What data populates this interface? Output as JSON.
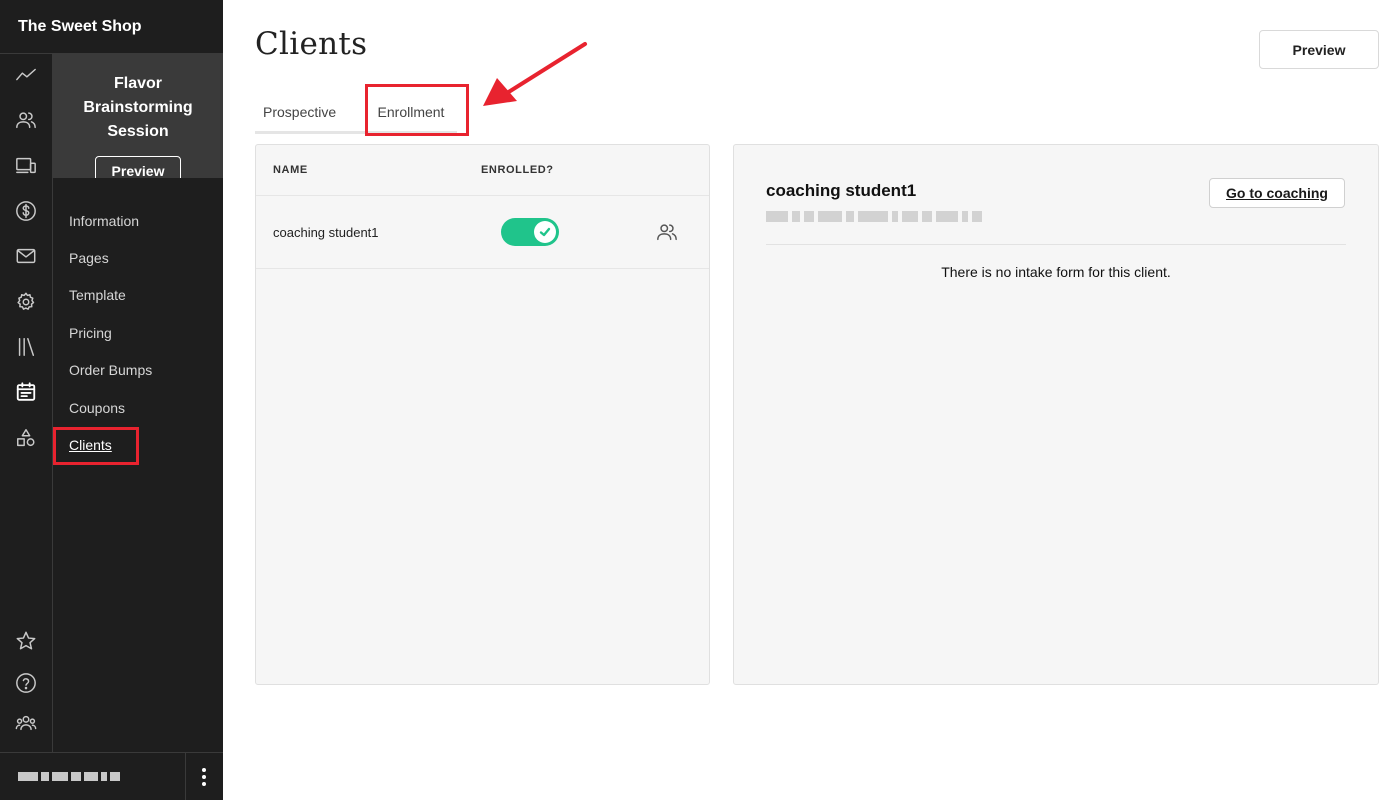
{
  "brand": {
    "name": "The Sweet Shop"
  },
  "rail": {
    "icons": [
      "analytics-icon",
      "people-icon",
      "devices-icon",
      "dollar-icon",
      "mail-icon",
      "settings-icon",
      "library-icon",
      "calendar-icon",
      "shapes-icon",
      "star-icon",
      "help-icon",
      "community-icon"
    ],
    "active": "calendar-icon"
  },
  "product": {
    "title": "Flavor Brainstorming Session",
    "preview_label": "Preview"
  },
  "menu": {
    "items": [
      "Information",
      "Pages",
      "Template",
      "Pricing",
      "Order Bumps",
      "Coupons",
      "Clients"
    ],
    "selected": "Clients"
  },
  "main": {
    "title": "Clients",
    "preview_label": "Preview",
    "tabs": [
      "Prospective",
      "Enrollment"
    ],
    "active_tab": "Enrollment"
  },
  "table": {
    "headers": {
      "name": "NAME",
      "enrolled": "ENROLLED?"
    },
    "rows": [
      {
        "name": "coaching student1",
        "enrolled": true
      }
    ]
  },
  "detail": {
    "client_name": "coaching student1",
    "goto_label": "Go to coaching",
    "no_intake_text": "There is no intake form for this client."
  },
  "colors": {
    "sidebar_bg": "#1e1e1e",
    "toggle_on": "#20c48b",
    "highlight": "#e8232f"
  }
}
